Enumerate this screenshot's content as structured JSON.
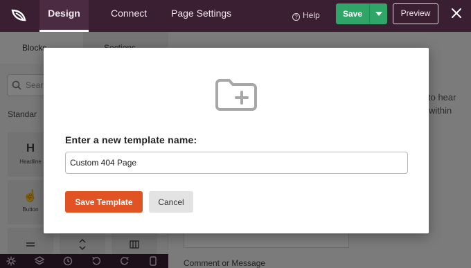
{
  "app": {
    "logo_icon": "seedprod-leaf-icon",
    "tabs": [
      {
        "label": "Design",
        "active": true
      },
      {
        "label": "Connect",
        "active": false
      },
      {
        "label": "Page Settings",
        "active": false
      }
    ],
    "help_label": "Help",
    "help_icon": "question-circle-icon",
    "save_label": "Save",
    "save_menu_icon": "caret-down-icon",
    "preview_label": "Preview",
    "close_icon": "close-icon",
    "colors": {
      "topbar": "#3a1e32",
      "save_button": "#2fa567",
      "primary_action": "#e15322"
    }
  },
  "left_panel": {
    "tabs": [
      {
        "label": "Blocks",
        "icon": "blocks-icon"
      },
      {
        "label": "Sections",
        "icon": "sections-icon"
      }
    ],
    "search_placeholder": "Sear",
    "group_title": "Standar",
    "tiles": [
      {
        "glyph": "H",
        "label": "Headline"
      },
      {
        "glyph": "☝",
        "label": "Button"
      }
    ]
  },
  "canvas": {
    "snippet_line1": "to hear",
    "snippet_line2": "within",
    "field_label": "Comment or Message"
  },
  "bottom_toolbar": {
    "icons": [
      "gear-icon",
      "layers-icon",
      "history-icon",
      "undo-icon",
      "redo-icon",
      "mobile-icon"
    ]
  },
  "modal": {
    "icon": "folder-add-icon",
    "label": "Enter a new template name:",
    "input_value": "Custom 404 Page",
    "save_label": "Save Template",
    "cancel_label": "Cancel"
  }
}
